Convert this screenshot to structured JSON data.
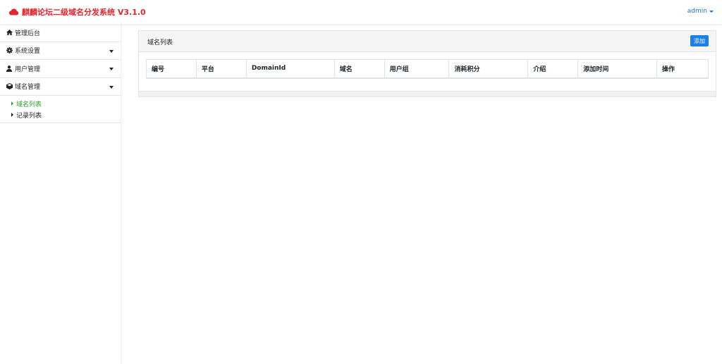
{
  "navbar": {
    "brand_icon": "cloud-icon",
    "brand_color": "#e3242b",
    "title": "麒麟论坛二级域名分发系统 V3.1.0",
    "user": "admin"
  },
  "sidebar": {
    "items": [
      {
        "label": "管理后台",
        "icon": "home-icon"
      },
      {
        "label": "系统设置",
        "icon": "gear-icon"
      },
      {
        "label": "用户管理",
        "icon": "user-icon"
      },
      {
        "label": "域名管理",
        "icon": "cube-icon"
      }
    ],
    "submenu": [
      {
        "label": "域名列表",
        "active": true
      },
      {
        "label": "记录列表",
        "active": false
      }
    ]
  },
  "main": {
    "card_title": "域名列表",
    "add_button": "添加",
    "table": {
      "headers": [
        "编号",
        "平台",
        "DomainId",
        "域名",
        "用户组",
        "消耗积分",
        "介绍",
        "添加时间",
        "操作"
      ],
      "rows": []
    }
  },
  "colors": {
    "accent": "#1a7fe8",
    "active_link": "#2a9d2a"
  }
}
